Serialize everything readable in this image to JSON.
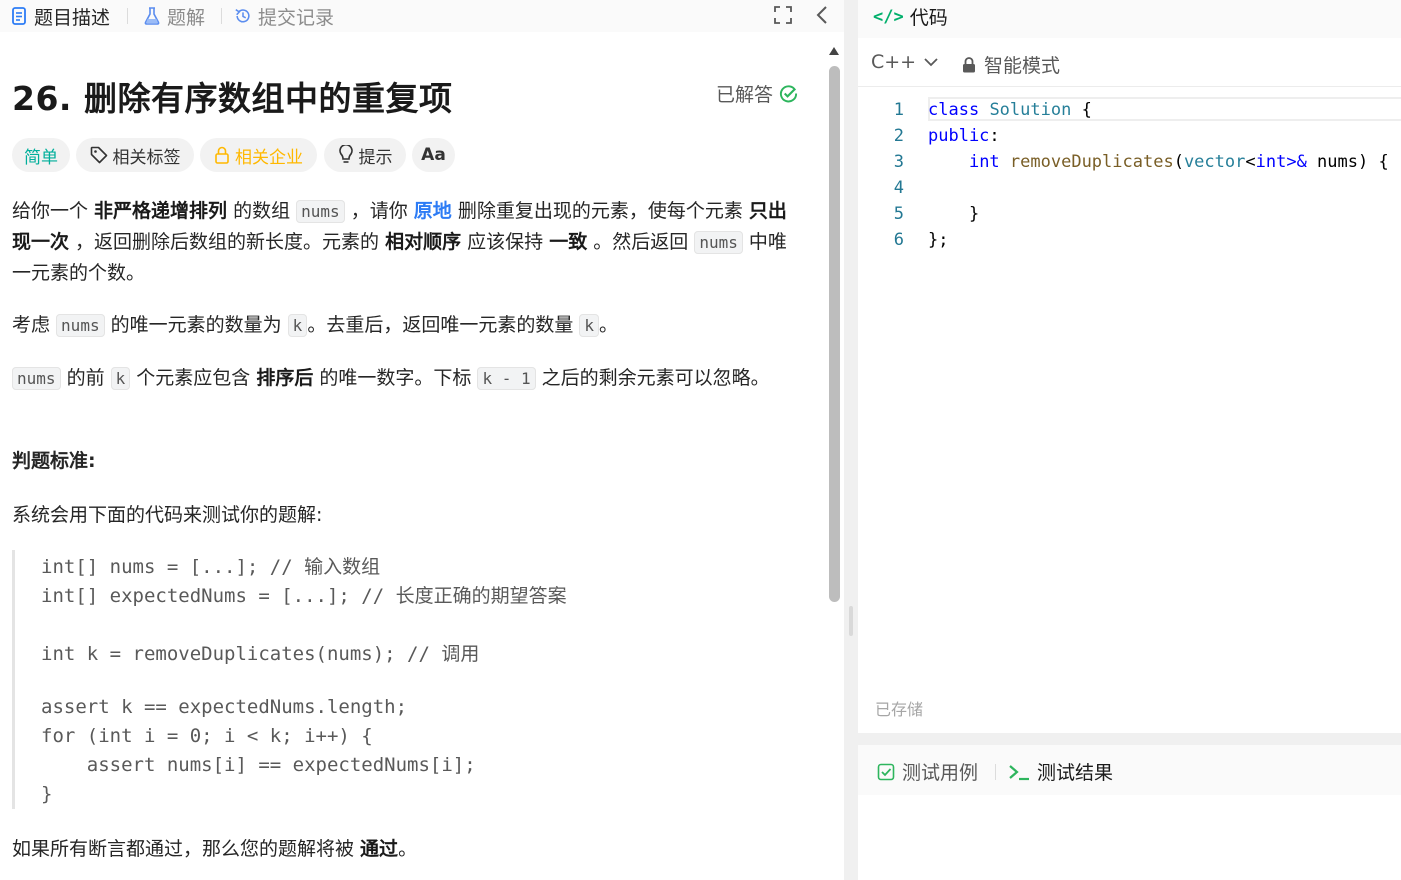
{
  "left_tabs": {
    "description": "题目描述",
    "solution": "题解",
    "submissions": "提交记录"
  },
  "problem": {
    "title": "26. 删除有序数组中的重复项",
    "status": "已解答",
    "difficulty": "简单",
    "chips": {
      "tags": "相关标签",
      "company": "相关企业",
      "hint": "提示",
      "font": "Aa"
    },
    "p1": {
      "a": "给你一个 ",
      "b": "非严格递增排列",
      "c": " 的数组 ",
      "code1": "nums",
      "d": " ，请你 ",
      "e": "原地",
      "f": " 删除重复出现的元素，使每个元素 ",
      "g": "只出现一次",
      "h": " ，返回删除后数组的新长度。元素的 ",
      "i": "相对顺序",
      "j": " 应该保持 ",
      "k": "一致",
      "l": " 。然后返回 ",
      "code2": "nums",
      "m": " 中唯一元素的个数。"
    },
    "p2": {
      "a": "考虑 ",
      "code1": "nums",
      "b": " 的唯一元素的数量为 ",
      "code2": "k",
      "c": "。去重后，返回唯一元素的数量 ",
      "code3": "k",
      "d": "。"
    },
    "p3": {
      "code1": "nums",
      "a": " 的前 ",
      "code2": "k",
      "b": " 个元素应包含 ",
      "c": "排序后",
      "d": " 的唯一数字。下标 ",
      "code3": "k - 1",
      "e": " 之后的剩余元素可以忽略。"
    },
    "judge_heading": "判题标准:",
    "judge_intro": "系统会用下面的代码来测试你的题解:",
    "judge_code": [
      "int[] nums = [...]; // 输入数组",
      "int[] expectedNums = [...]; // 长度正确的期望答案",
      "int k = removeDuplicates(nums); // 调用",
      "assert k == expectedNums.length;",
      "for (int i = 0; i < k; i++) {",
      "    assert nums[i] == expectedNums[i];",
      "}"
    ],
    "p4": {
      "a": "如果所有断言都通过，那么您的题解将被 ",
      "b": "通过",
      "c": "。"
    }
  },
  "editor": {
    "tab": "代码",
    "language": "C++",
    "mode": "智能模式",
    "line_numbers": [
      "1",
      "2",
      "3",
      "4",
      "5",
      "6"
    ],
    "code": {
      "l1_kw": "class",
      "l1_ty": "Solution",
      "l1_rest": " {",
      "l2_kw": "public",
      "l2_rest": ":",
      "l3_kw": "int",
      "l3_fn": "removeDuplicates",
      "l3_p1": "(",
      "l3_ty": "vector",
      "l3_lt": "<",
      "l3_kw2": "int",
      "l3_gt": ">&",
      "l3_rest": " nums) {",
      "l5": "}",
      "l6": "};"
    },
    "saved": "已存储"
  },
  "test": {
    "cases": "测试用例",
    "results": "测试结果"
  },
  "colors": {
    "easy": "#00af9b",
    "company": "#ffb800",
    "solved_check": "#2db55d",
    "link_blue": "#2d7cf5",
    "code_tab_icon": "#00af6b"
  }
}
